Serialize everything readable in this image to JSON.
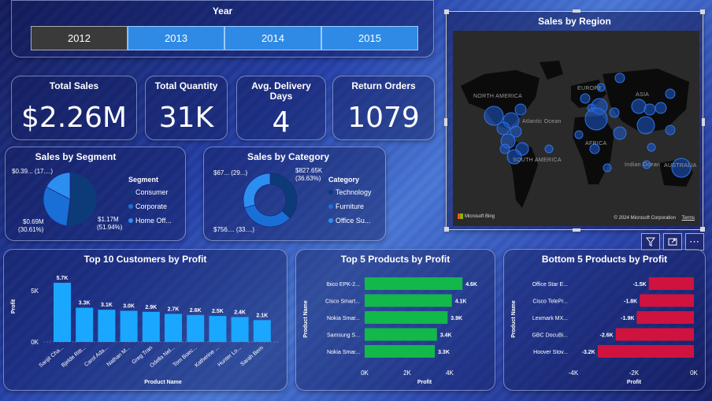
{
  "year_slicer": {
    "title": "Year",
    "options": [
      "2012",
      "2013",
      "2014",
      "2015"
    ],
    "selected": "2012"
  },
  "kpis": [
    {
      "label": "Total Sales",
      "value": "$2.26M"
    },
    {
      "label": "Total Quantity",
      "value": "31K"
    },
    {
      "label": "Avg. Delivery Days",
      "value": "4"
    },
    {
      "label": "Return Orders",
      "value": "1079"
    }
  ],
  "map": {
    "title": "Sales by Region",
    "labels": [
      "NORTH AMERICA",
      "Atlantic Ocean",
      "AFRICA",
      "SOUTH AMERICA",
      "Indian Ocean",
      "EUROPE",
      "ASIA",
      "AUSTRALIA"
    ],
    "brand": "Microsoft Bing",
    "copyright": "© 2024 Microsoft Corporation",
    "terms": "Terms"
  },
  "segment": {
    "title": "Sales by Segment",
    "legend_title": "Segment",
    "items": [
      {
        "name": "Consumer",
        "color": "#0d3a78"
      },
      {
        "name": "Corporate",
        "color": "#1a6fd6"
      },
      {
        "name": "Home Off...",
        "color": "#2c8ff0"
      }
    ],
    "labels": [
      "$0.39... (17....)",
      "$0.69M",
      "(30.61%)",
      "$1.17M",
      "(51.94%)"
    ]
  },
  "category": {
    "title": "Sales by Category",
    "legend_title": "Category",
    "items": [
      {
        "name": "Technology",
        "color": "#0d3a78"
      },
      {
        "name": "Furniture",
        "color": "#1a6fd6"
      },
      {
        "name": "Office Su...",
        "color": "#2c8ff0"
      }
    ],
    "labels": [
      "$67... (29...)",
      "$827.65K",
      "(36.63%)",
      "$756.... (33....)"
    ]
  },
  "top_customers": {
    "title": "Top 10 Customers by Profit",
    "xlabel": "Product Name",
    "ylabel": "Profit",
    "y_ticks": [
      "5K",
      "0K"
    ],
    "bar_labels": [
      "5.7K",
      "3.3K",
      "3.1K",
      "3.0K",
      "2.9K",
      "2.7K",
      "2.6K",
      "2.5K",
      "2.4K",
      "2.1K"
    ],
    "categories": [
      "Sanjit Cha...",
      "Bjelde Ritt...",
      "Carol Ada...",
      "Nathan M...",
      "Greg Tran",
      "Odella Nel...",
      "Tom Boec...",
      "Katherine ...",
      "Hunter Lo...",
      "Sarah Bern"
    ]
  },
  "top_products": {
    "title": "Top 5 Products by Profit",
    "xlabel": "Profit",
    "ylabel": "Product Name",
    "x_ticks": [
      "0K",
      "2K",
      "4K"
    ],
    "bar_labels": [
      "4.6K",
      "4.1K",
      "3.9K",
      "3.4K",
      "3.3K"
    ],
    "categories": [
      "Ibico EPK-2...",
      "Cisco Smart...",
      "Nokia Smar...",
      "Samsung S...",
      "Nokia Smar..."
    ],
    "color": "#12b84a"
  },
  "bottom_products": {
    "title": "Bottom 5 Products by Profit",
    "xlabel": "Profit",
    "ylabel": "Product Name",
    "x_ticks": [
      "-4K",
      "-2K",
      "0K"
    ],
    "bar_labels": [
      "-1.5K",
      "-1.8K",
      "-1.9K",
      "-2.6K",
      "-3.2K"
    ],
    "categories": [
      "Office Star E...",
      "Cisco TelePr...",
      "Lexmark MX...",
      "GBC DocuBi...",
      "Hoover Stov..."
    ],
    "color": "#d0123f"
  },
  "chart_data": [
    {
      "type": "pie",
      "title": "Sales by Segment",
      "legend": "right",
      "categories": [
        "Consumer",
        "Corporate",
        "Home Office"
      ],
      "values": [
        1.17,
        0.69,
        0.39
      ],
      "unit": "$M"
    },
    {
      "type": "pie",
      "title": "Sales by Category",
      "legend": "right",
      "categories": [
        "Technology",
        "Furniture",
        "Office Supplies"
      ],
      "values": [
        827.65,
        756,
        670
      ],
      "unit": "$K"
    },
    {
      "type": "bar",
      "title": "Top 10 Customers by Profit",
      "xlabel": "Product Name",
      "ylabel": "Profit",
      "categories": [
        "Sanjit Cha...",
        "Bjelde Ritt...",
        "Carol Ada...",
        "Nathan M...",
        "Greg Tran",
        "Odella Nel...",
        "Tom Boec...",
        "Katherine ...",
        "Hunter Lo...",
        "Sarah Bern"
      ],
      "values": [
        5.7,
        3.3,
        3.1,
        3.0,
        2.9,
        2.7,
        2.6,
        2.5,
        2.4,
        2.1
      ],
      "unit": "K",
      "ylim": [
        0,
        6
      ]
    },
    {
      "type": "bar",
      "orientation": "horizontal",
      "title": "Top 5 Products by Profit",
      "xlabel": "Profit",
      "ylabel": "Product Name",
      "categories": [
        "Ibico EPK-2...",
        "Cisco Smart...",
        "Nokia Smar...",
        "Samsung S...",
        "Nokia Smar..."
      ],
      "values": [
        4.6,
        4.1,
        3.9,
        3.4,
        3.3
      ],
      "unit": "K",
      "xlim": [
        0,
        4.6
      ]
    },
    {
      "type": "bar",
      "orientation": "horizontal",
      "title": "Bottom 5 Products by Profit",
      "xlabel": "Profit",
      "ylabel": "Product Name",
      "categories": [
        "Office Star E...",
        "Cisco TelePr...",
        "Lexmark MX...",
        "GBC DocuBi...",
        "Hoover Stov..."
      ],
      "values": [
        -1.5,
        -1.8,
        -1.9,
        -2.6,
        -3.2
      ],
      "unit": "K",
      "xlim": [
        -4,
        0
      ]
    }
  ]
}
